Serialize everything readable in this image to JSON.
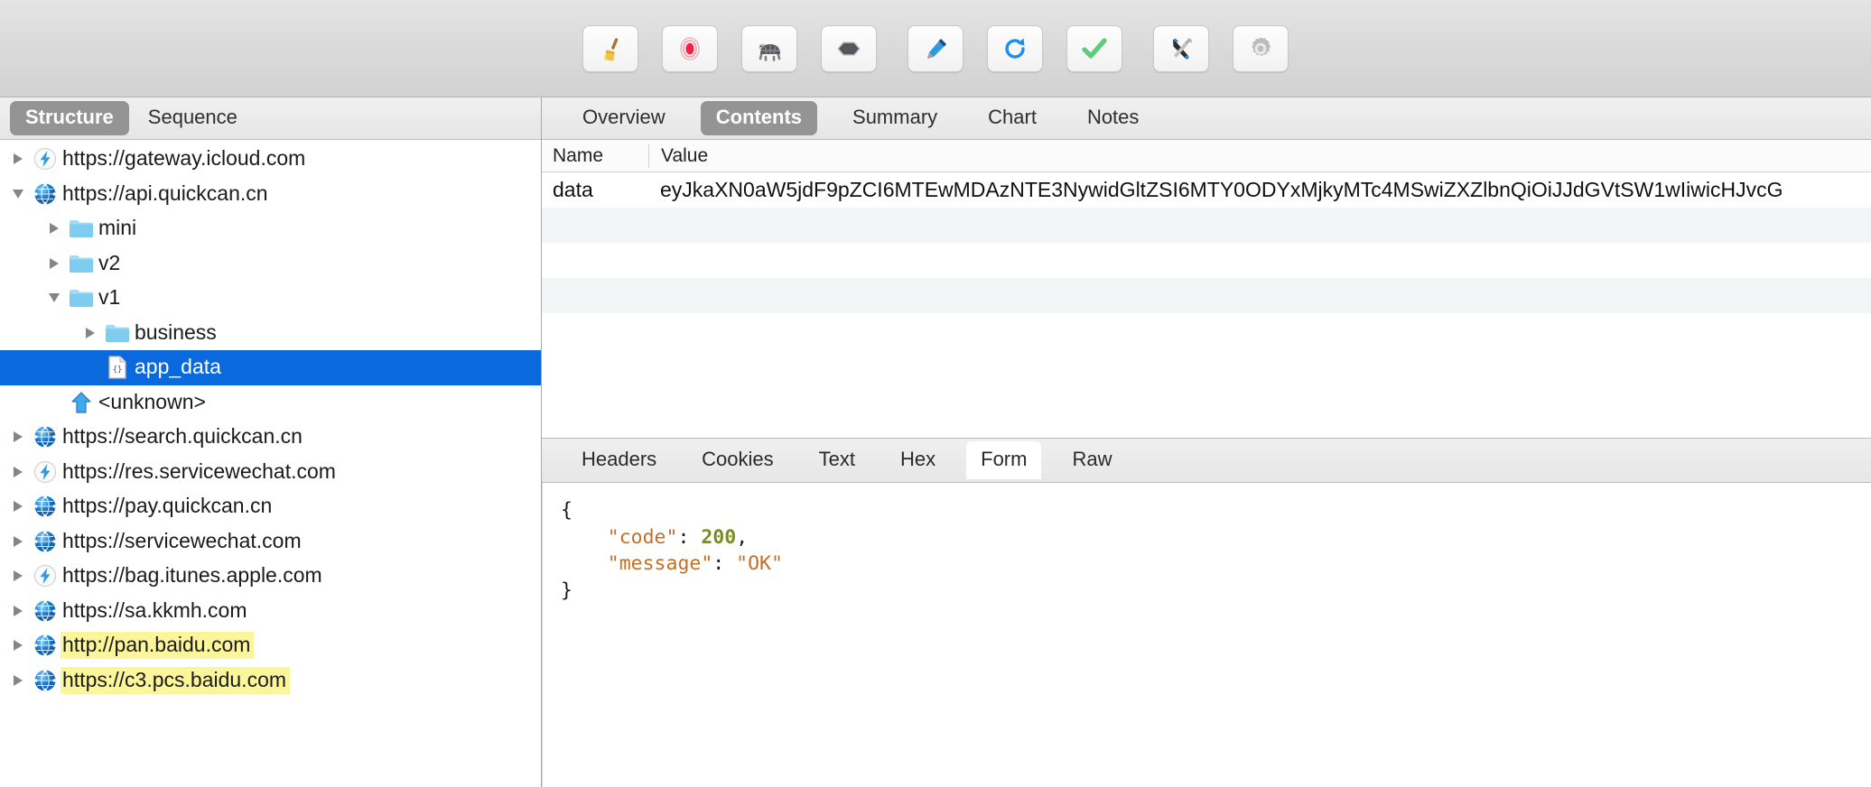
{
  "toolbar": {
    "buttons": [
      {
        "name": "clear-session-button",
        "icon": "broom-icon",
        "label": "Clear"
      },
      {
        "name": "record-button",
        "icon": "record-icon",
        "label": "Record"
      },
      {
        "name": "throttle-button",
        "icon": "turtle-icon",
        "label": "Throttle"
      },
      {
        "name": "breakpoints-button",
        "icon": "hexagon-icon",
        "label": "Breakpoints"
      },
      {
        "name": "compose-button",
        "icon": "pen-icon",
        "label": "Compose"
      },
      {
        "name": "repeat-button",
        "icon": "refresh-icon",
        "label": "Repeat"
      },
      {
        "name": "validate-button",
        "icon": "checkmark-icon",
        "label": "Validate"
      },
      {
        "name": "tools-button",
        "icon": "tools-icon",
        "label": "Tools"
      },
      {
        "name": "settings-button",
        "icon": "gear-icon",
        "label": "Settings"
      }
    ]
  },
  "left_pane": {
    "tabs": [
      {
        "label": "Structure",
        "active": true
      },
      {
        "label": "Sequence",
        "active": false
      }
    ],
    "tree": [
      {
        "label": "https://gateway.icloud.com",
        "indent": 0,
        "twisty": "collapsed",
        "icon": "bolt-icon",
        "selected": false,
        "highlight": false
      },
      {
        "label": "https://api.quickcan.cn",
        "indent": 0,
        "twisty": "expanded",
        "icon": "globe-icon",
        "selected": false,
        "highlight": false
      },
      {
        "label": "mini",
        "indent": 1,
        "twisty": "collapsed",
        "icon": "folder-icon",
        "selected": false,
        "highlight": false
      },
      {
        "label": "v2",
        "indent": 1,
        "twisty": "collapsed",
        "icon": "folder-icon",
        "selected": false,
        "highlight": false
      },
      {
        "label": "v1",
        "indent": 1,
        "twisty": "expanded",
        "icon": "folder-icon",
        "selected": false,
        "highlight": false
      },
      {
        "label": "business",
        "indent": 2,
        "twisty": "collapsed",
        "icon": "folder-icon",
        "selected": false,
        "highlight": false
      },
      {
        "label": "app_data",
        "indent": 2,
        "twisty": "none",
        "icon": "json-file-icon",
        "selected": true,
        "highlight": false
      },
      {
        "label": "<unknown>",
        "indent": 1,
        "twisty": "none",
        "icon": "upload-arrow-icon",
        "selected": false,
        "highlight": false
      },
      {
        "label": "https://search.quickcan.cn",
        "indent": 0,
        "twisty": "collapsed",
        "icon": "globe-icon",
        "selected": false,
        "highlight": false
      },
      {
        "label": "https://res.servicewechat.com",
        "indent": 0,
        "twisty": "collapsed",
        "icon": "bolt-icon",
        "selected": false,
        "highlight": false
      },
      {
        "label": "https://pay.quickcan.cn",
        "indent": 0,
        "twisty": "collapsed",
        "icon": "globe-icon",
        "selected": false,
        "highlight": false
      },
      {
        "label": "https://servicewechat.com",
        "indent": 0,
        "twisty": "collapsed",
        "icon": "globe-icon",
        "selected": false,
        "highlight": false
      },
      {
        "label": "https://bag.itunes.apple.com",
        "indent": 0,
        "twisty": "collapsed",
        "icon": "bolt-icon",
        "selected": false,
        "highlight": false
      },
      {
        "label": "https://sa.kkmh.com",
        "indent": 0,
        "twisty": "collapsed",
        "icon": "globe-icon",
        "selected": false,
        "highlight": false
      },
      {
        "label": "http://pan.baidu.com",
        "indent": 0,
        "twisty": "collapsed",
        "icon": "globe-icon",
        "selected": false,
        "highlight": true
      },
      {
        "label": "https://c3.pcs.baidu.com",
        "indent": 0,
        "twisty": "collapsed",
        "icon": "globe-icon",
        "selected": false,
        "highlight": true
      }
    ]
  },
  "right_pane": {
    "tabs": [
      {
        "label": "Overview",
        "active": false
      },
      {
        "label": "Contents",
        "active": true
      },
      {
        "label": "Summary",
        "active": false
      },
      {
        "label": "Chart",
        "active": false
      },
      {
        "label": "Notes",
        "active": false
      }
    ],
    "contents_table": {
      "columns": [
        "Name",
        "Value"
      ],
      "rows": [
        {
          "name": "data",
          "value": "eyJkaXN0aW5jdF9pZCI6MTEwMDAzNTE3NywidGltZSI6MTY0ODYxMjkyMTc4MSwiZXZlbnQiOiJJdGVtSW1wIiwicHJvcG"
        },
        {
          "name": "",
          "value": ""
        },
        {
          "name": "",
          "value": ""
        },
        {
          "name": "",
          "value": ""
        },
        {
          "name": "",
          "value": ""
        }
      ]
    },
    "sub_tabs": [
      {
        "label": "Headers",
        "active": false
      },
      {
        "label": "Cookies",
        "active": false
      },
      {
        "label": "Text",
        "active": false
      },
      {
        "label": "Hex",
        "active": false
      },
      {
        "label": "Form",
        "active": true
      },
      {
        "label": "Raw",
        "active": false
      }
    ],
    "json_body": {
      "open_brace": "{",
      "close_brace": "}",
      "entries": [
        {
          "key": "\"code\"",
          "colon": ": ",
          "value": "200",
          "value_type": "number",
          "trailing": ","
        },
        {
          "key": "\"message\"",
          "colon": ": ",
          "value": "\"OK\"",
          "value_type": "string",
          "trailing": ""
        }
      ]
    }
  },
  "colors": {
    "selection_blue": "#0a69dc",
    "highlight_yellow": "#fcf69a",
    "active_tab_gray": "#949494",
    "json_key": "#c1702a",
    "json_number": "#7d8c22"
  }
}
